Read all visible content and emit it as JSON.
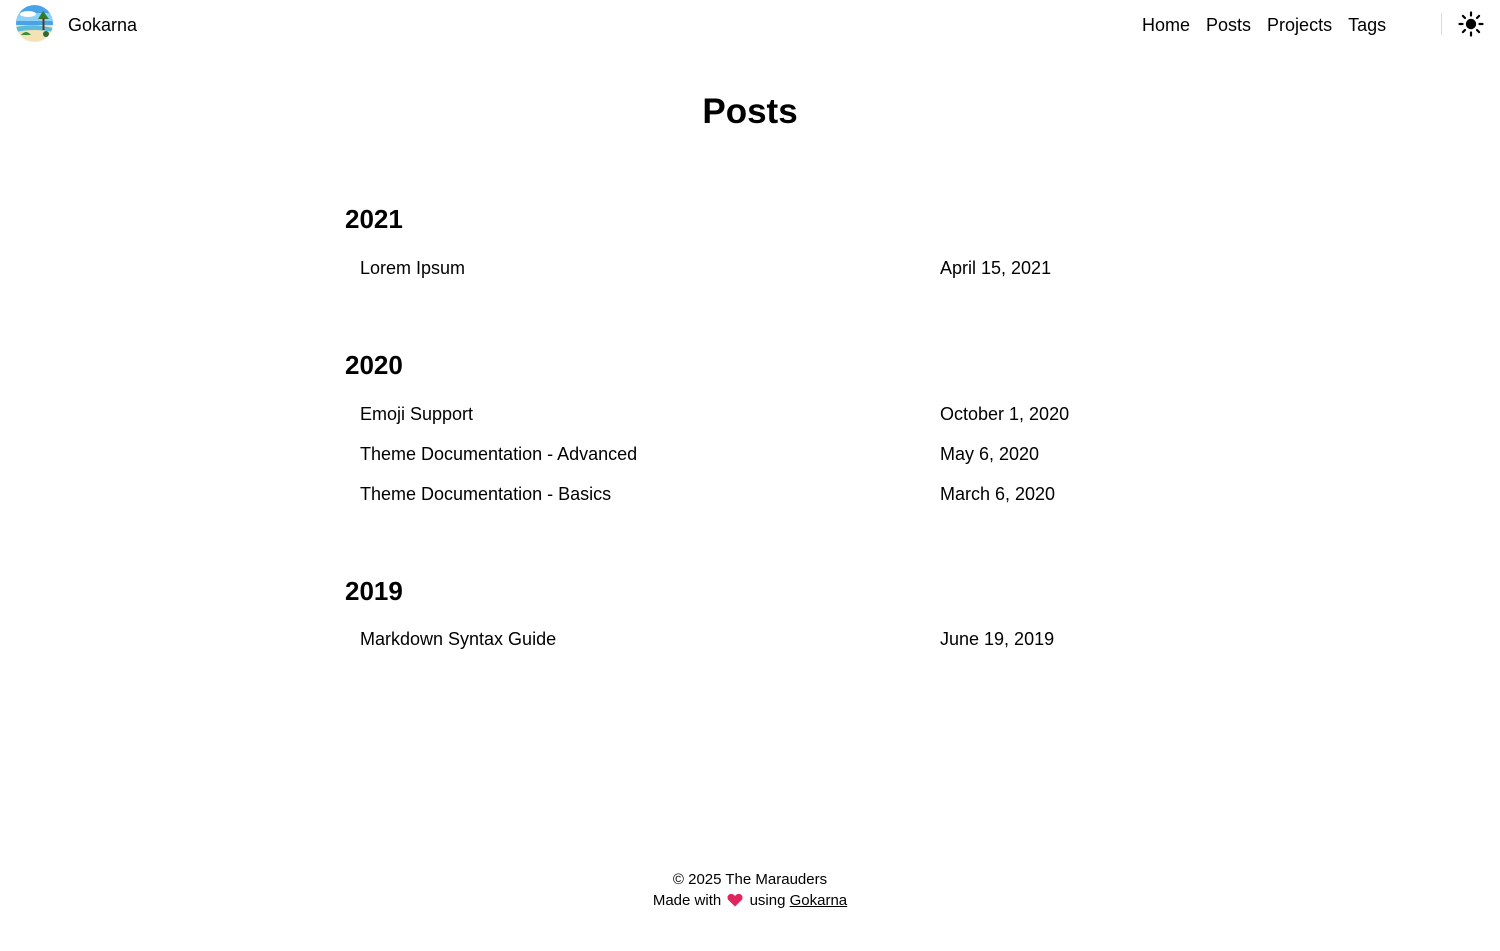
{
  "header": {
    "site_title": "Gokarna",
    "nav": [
      {
        "label": "Home"
      },
      {
        "label": "Posts"
      },
      {
        "label": "Projects"
      },
      {
        "label": "Tags"
      }
    ],
    "theme_toggle_icon": "sun-icon"
  },
  "main": {
    "title": "Posts",
    "years": [
      {
        "year": "2021",
        "posts": [
          {
            "title": "Lorem Ipsum",
            "date": "April 15, 2021"
          }
        ]
      },
      {
        "year": "2020",
        "posts": [
          {
            "title": "Emoji Support",
            "date": "October 1, 2020"
          },
          {
            "title": "Theme Documentation - Advanced",
            "date": "May 6, 2020"
          },
          {
            "title": "Theme Documentation - Basics",
            "date": "March 6, 2020"
          }
        ]
      },
      {
        "year": "2019",
        "posts": [
          {
            "title": "Markdown Syntax Guide",
            "date": "June 19, 2019"
          }
        ]
      }
    ]
  },
  "footer": {
    "copyright": "© 2025 The Marauders",
    "made_with_prefix": "Made with",
    "heart_icon": "heart-icon",
    "made_with_suffix": "using",
    "theme_link": "Gokarna",
    "heart_color": "#e0245e"
  }
}
